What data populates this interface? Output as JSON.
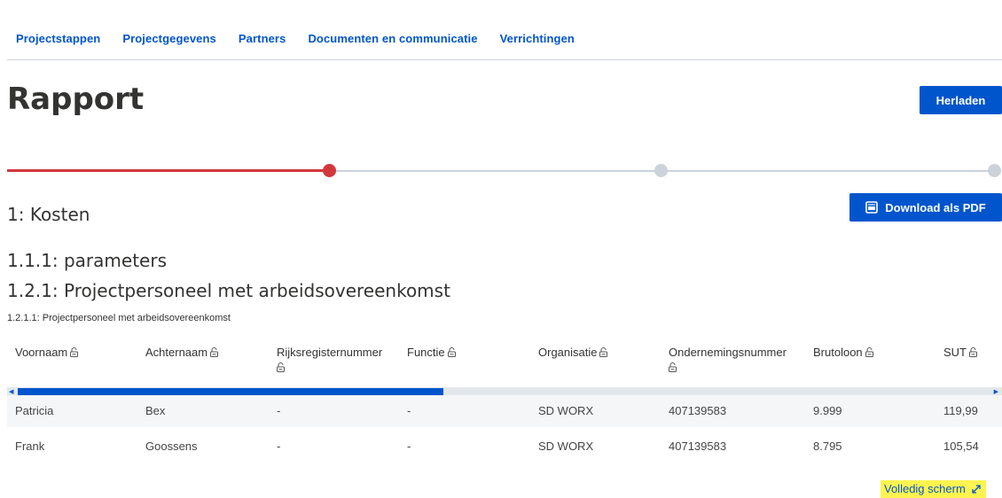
{
  "nav": {
    "items": [
      "Projectstappen",
      "Projectgegevens",
      "Partners",
      "Documenten en communicatie",
      "Verrichtingen"
    ]
  },
  "page": {
    "title": "Rapport",
    "reload_label": "Herladen",
    "download_label": "Download als PDF"
  },
  "progress": {
    "current_step": 1,
    "total_steps": 3
  },
  "sections": {
    "kosten": "1: Kosten",
    "parameters": "1.1.1: parameters",
    "personeel": "1.2.1: Projectpersoneel met arbeidsovereenkomst",
    "table_caption": "1.2.1.1: Projectpersoneel met arbeidsovereenkomst"
  },
  "table": {
    "headers": {
      "voornaam": "Voornaam",
      "achternaam": "Achternaam",
      "rijksregister": "Rijksregisternummer",
      "functie": "Functie",
      "organisatie": "Organisatie",
      "ondernemingsnummer": "Ondernemingsnummer",
      "brutoloon": "Brutoloon",
      "sut": "SUT"
    },
    "rows": [
      {
        "voornaam": "Patricia",
        "achternaam": "Bex",
        "rijksregister": "-",
        "functie": "-",
        "organisatie": "SD WORX",
        "ondernemingsnummer": "407139583",
        "brutoloon": "9.999",
        "sut": "119,99"
      },
      {
        "voornaam": "Frank",
        "achternaam": "Goossens",
        "rijksregister": "-",
        "functie": "-",
        "organisatie": "SD WORX",
        "ondernemingsnummer": "407139583",
        "brutoloon": "8.795",
        "sut": "105,54"
      }
    ]
  },
  "fullscreen_label": "Volledig scherm",
  "colors": {
    "accent": "#0055cc",
    "progress_done": "#d2373c",
    "progress_todo": "#cbd2da",
    "highlight": "#fff44f"
  },
  "icons": {
    "lock": "unlocked-padlock-icon",
    "pdf": "pdf-file-icon",
    "expand": "expand-arrows-icon"
  }
}
